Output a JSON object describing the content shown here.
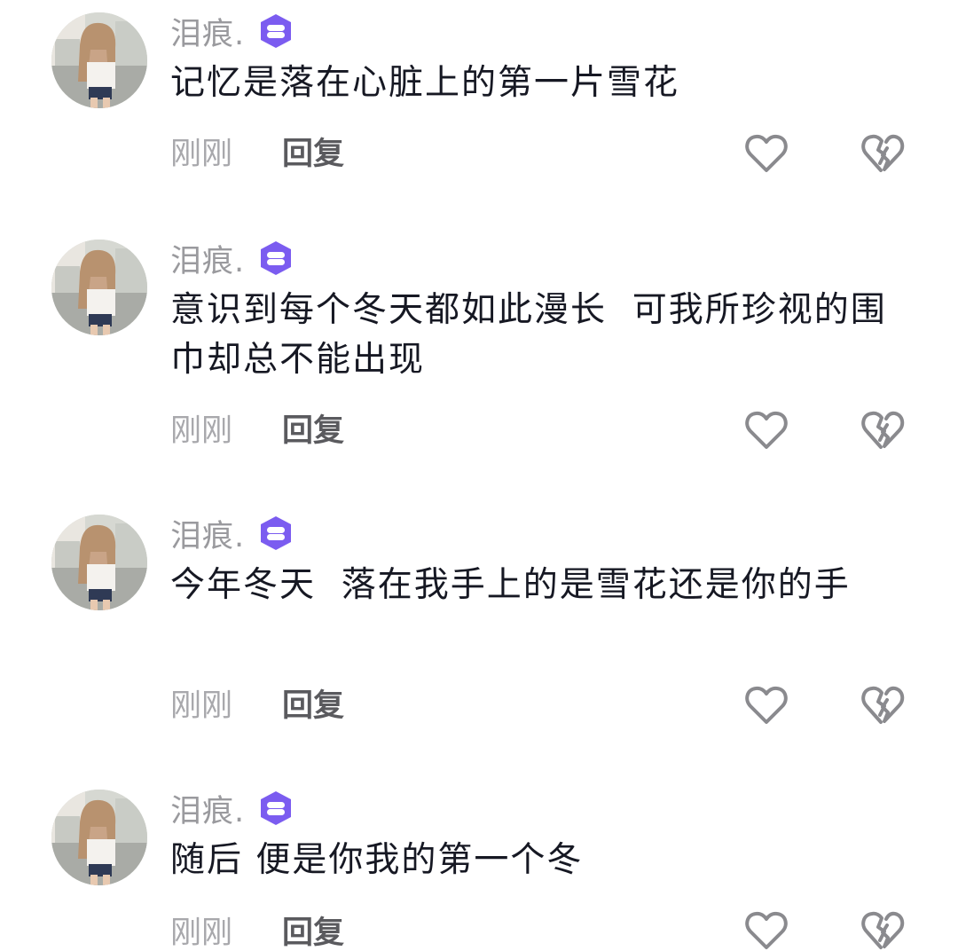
{
  "comments": [
    {
      "username": "泪痕.",
      "text": "记忆是落在心脏上的第一片雪花",
      "time": "刚刚",
      "reply_label": "回复"
    },
    {
      "username": "泪痕.",
      "text": "意识到每个冬天都如此漫长  可我所珍视的围巾却总不能出现",
      "time": "刚刚",
      "reply_label": "回复"
    },
    {
      "username": "泪痕.",
      "text": "今年冬天  落在我手上的是雪花还是你的手",
      "time": "刚刚",
      "reply_label": "回复"
    },
    {
      "username": "泪痕.",
      "text": "随后 便是你我的第一个冬",
      "time": "刚刚",
      "reply_label": "回复"
    }
  ],
  "icons": {
    "badge": "purple-chat-badge-icon",
    "like": "heart-outline-icon",
    "dislike": "broken-heart-icon"
  },
  "colors": {
    "badge": "#7b5cf0",
    "text": "#161823",
    "muted": "#a8a8ac"
  }
}
